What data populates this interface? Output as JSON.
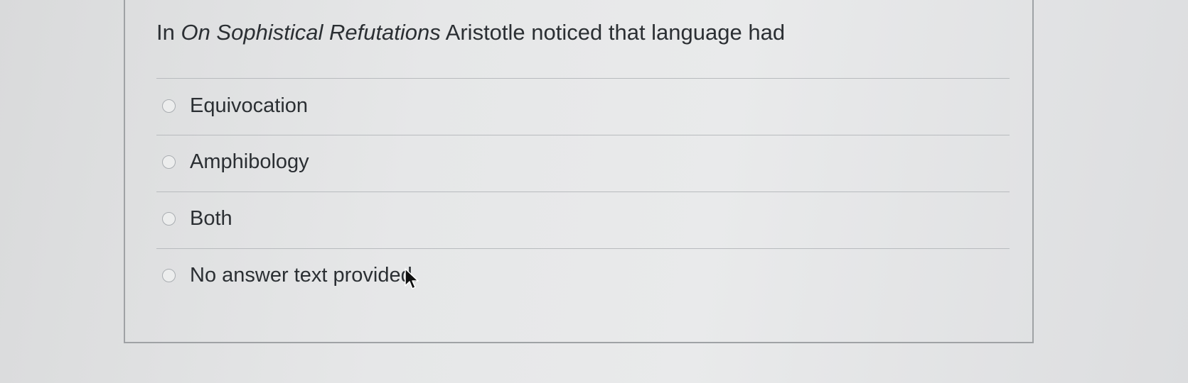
{
  "question": {
    "prefix": "In ",
    "title_italic": "On Sophistical Refutations",
    "suffix": " Aristotle noticed that language had"
  },
  "answers": [
    {
      "label": "Equivocation",
      "selected": false
    },
    {
      "label": "Amphibology",
      "selected": false
    },
    {
      "label": "Both",
      "selected": false
    },
    {
      "label": "No answer text provided.",
      "selected": false
    }
  ],
  "icons": {
    "radio": "radio-circle-icon",
    "cursor": "mouse-pointer-icon"
  }
}
